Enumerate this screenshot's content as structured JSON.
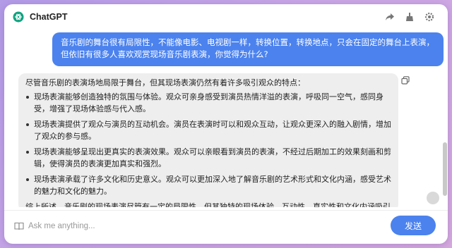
{
  "app": {
    "title": "ChatGPT"
  },
  "header": {
    "actions": [
      {
        "icon": "share-icon"
      },
      {
        "icon": "clean-icon"
      },
      {
        "icon": "settings-icon"
      }
    ]
  },
  "conversation": {
    "user_message": "音乐剧的舞台很有局限性，不能像电影、电视剧一样，转换位置，转换地点，只会在固定的舞台上表演，但依旧有很多人喜欢观赏现场音乐剧表演，你觉得为什么?",
    "assistant": {
      "intro": "尽管音乐剧的表演场地局限于舞台，但其现场表演仍然有着许多吸引观众的特点：",
      "points": [
        "现场表演能够创造独特的氛围与体验。观众可亲身感受到演员热情洋溢的表演，呼吸同一空气，感同身受，增强了现场体验感与代入感。",
        "现场表演提供了观众与演员的互动机会。演员在表演时可以和观众互动，让观众更深入的融入剧情，增加了观众的参与感。",
        "现场表演能够呈现出更真实的表演效果。观众可以亲眼看到演员的表演，不经过后期加工的效果刻画和剪辑，使得演员的表演更加真实和强烈。",
        "现场表演承载了许多文化和历史意义。观众可以更加深入地了解音乐剧的艺术形式和文化内涵，感受艺术的魅力和文化的魅力。"
      ],
      "conclusion": "综上所述，音乐剧的现场表演尽管有一定的局限性，但其独特的现场体验、互动性、真实性和文化内涵吸引了许多观众前来观赏。"
    }
  },
  "input": {
    "placeholder": "Ask me anything...",
    "send_label": "发送"
  },
  "colors": {
    "accent": "#4b82ee",
    "assistant_bubble": "#eeeeee",
    "background_gradient_start": "#b39be8",
    "background_gradient_end": "#d6a9df"
  }
}
